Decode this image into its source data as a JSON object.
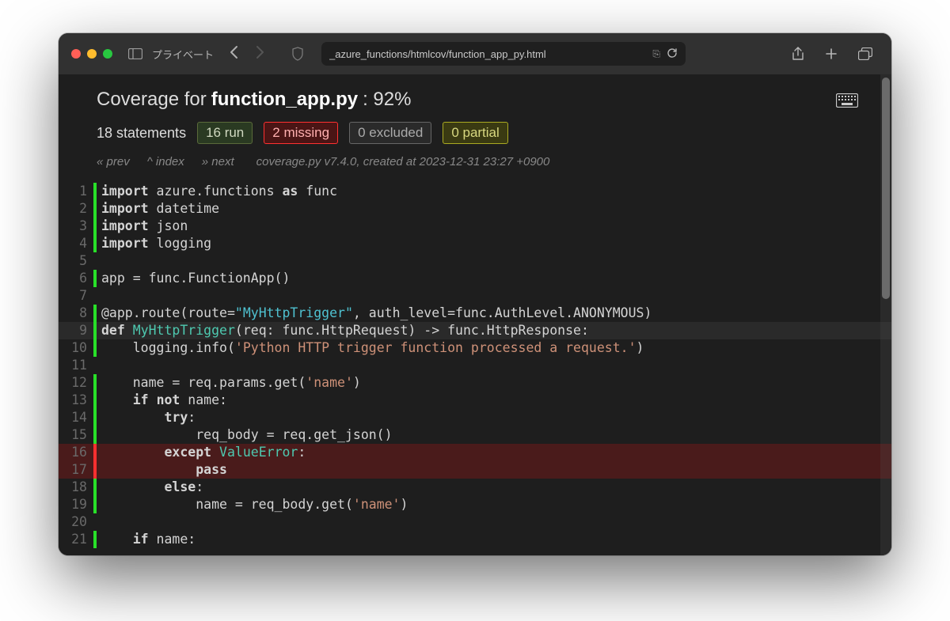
{
  "browser": {
    "private_label": "プライベート",
    "url": "_azure_functions/htmlcov/function_app_py.html"
  },
  "header": {
    "title_prefix": "Coverage for ",
    "filename": "function_app.py",
    "percent": ": 92%",
    "statements": "18 statements",
    "run": "16 run",
    "missing": "2 missing",
    "excluded": "0 excluded",
    "partial": "0 partial"
  },
  "nav": {
    "prev": "« prev",
    "index": "^ index",
    "next": "» next",
    "info": "coverage.py v7.4.0, created at 2023-12-31 23:27 +0900"
  },
  "code": {
    "lines": [
      {
        "n": 1,
        "status": "run",
        "tokens": [
          [
            "kw",
            "import"
          ],
          [
            "",
            " azure.functions "
          ],
          [
            "kw",
            "as"
          ],
          [
            "",
            " func"
          ]
        ]
      },
      {
        "n": 2,
        "status": "run",
        "tokens": [
          [
            "kw",
            "import"
          ],
          [
            "",
            " datetime"
          ]
        ]
      },
      {
        "n": 3,
        "status": "run",
        "tokens": [
          [
            "kw",
            "import"
          ],
          [
            "",
            " json"
          ]
        ]
      },
      {
        "n": 4,
        "status": "run",
        "tokens": [
          [
            "kw",
            "import"
          ],
          [
            "",
            " logging"
          ]
        ]
      },
      {
        "n": 5,
        "status": "none",
        "tokens": []
      },
      {
        "n": 6,
        "status": "run",
        "tokens": [
          [
            "",
            "app = func.FunctionApp()"
          ]
        ]
      },
      {
        "n": 7,
        "status": "none",
        "tokens": []
      },
      {
        "n": 8,
        "status": "run",
        "tokens": [
          [
            "",
            "@app.route(route="
          ],
          [
            "strb",
            "\"MyHttpTrigger\""
          ],
          [
            "",
            ", auth_level=func.AuthLevel.ANONYMOUS)"
          ]
        ]
      },
      {
        "n": 9,
        "status": "run",
        "highlight": true,
        "tokens": [
          [
            "kw",
            "def"
          ],
          [
            "",
            " "
          ],
          [
            "cls",
            "MyHttpTrigger"
          ],
          [
            "",
            "(req: func.HttpRequest) -> func.HttpResponse:"
          ]
        ]
      },
      {
        "n": 10,
        "status": "run",
        "tokens": [
          [
            "",
            "    logging.info("
          ],
          [
            "str",
            "'Python HTTP trigger function processed a request.'"
          ],
          [
            "",
            ")"
          ]
        ]
      },
      {
        "n": 11,
        "status": "none",
        "tokens": []
      },
      {
        "n": 12,
        "status": "run",
        "tokens": [
          [
            "",
            "    name = req.params.get("
          ],
          [
            "str",
            "'name'"
          ],
          [
            "",
            ")"
          ]
        ]
      },
      {
        "n": 13,
        "status": "run",
        "tokens": [
          [
            "",
            "    "
          ],
          [
            "kw",
            "if"
          ],
          [
            "",
            " "
          ],
          [
            "kw",
            "not"
          ],
          [
            "",
            " name:"
          ]
        ]
      },
      {
        "n": 14,
        "status": "run",
        "tokens": [
          [
            "",
            "        "
          ],
          [
            "kw",
            "try"
          ],
          [
            "",
            ":"
          ]
        ]
      },
      {
        "n": 15,
        "status": "run",
        "tokens": [
          [
            "",
            "            req_body = req.get_json()"
          ]
        ]
      },
      {
        "n": 16,
        "status": "miss",
        "tokens": [
          [
            "",
            "        "
          ],
          [
            "kw",
            "except"
          ],
          [
            "",
            " "
          ],
          [
            "cls",
            "ValueError"
          ],
          [
            "",
            ":"
          ]
        ]
      },
      {
        "n": 17,
        "status": "miss",
        "tokens": [
          [
            "",
            "            "
          ],
          [
            "kw",
            "pass"
          ]
        ]
      },
      {
        "n": 18,
        "status": "run",
        "tokens": [
          [
            "",
            "        "
          ],
          [
            "kw",
            "else"
          ],
          [
            "",
            ":"
          ]
        ]
      },
      {
        "n": 19,
        "status": "run",
        "tokens": [
          [
            "",
            "            name = req_body.get("
          ],
          [
            "str",
            "'name'"
          ],
          [
            "",
            ")"
          ]
        ]
      },
      {
        "n": 20,
        "status": "none",
        "tokens": []
      },
      {
        "n": 21,
        "status": "run",
        "tokens": [
          [
            "",
            "    "
          ],
          [
            "kw",
            "if"
          ],
          [
            "",
            " name:"
          ]
        ]
      }
    ]
  }
}
